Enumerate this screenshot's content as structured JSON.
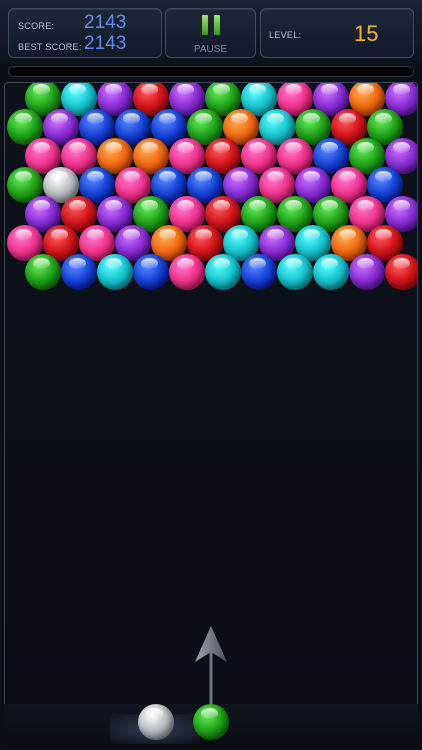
{
  "hud": {
    "score_label": "SCORE:",
    "score_value": "2143",
    "best_label": "BEST SCORE:",
    "best_value": "2143",
    "pause_label": "PAUSE",
    "level_label": "LEVEL:",
    "level_value": "15"
  },
  "colors": {
    "score_value": "#5c8ef0",
    "level_value": "#f3b23a",
    "pause_icon": "#55c23c"
  },
  "palette": {
    "G": "#22a51a",
    "C": "#19c6cf",
    "P": "#8b2fd6",
    "R": "#d2161c",
    "K": "#f0358e",
    "O": "#f06b12",
    "B": "#1745d8",
    "W": "#b9bec2"
  },
  "grid": [
    "GCPRPGCKPOP",
    "GPBBBGOCGRG",
    "KKOOKRKKBGP",
    "GWBKBBPKPKB",
    "PRPGKRGGGKP",
    "KRKPORCPCOR",
    "GBCBKCBCCPR"
  ],
  "shooter": {
    "current_color": "G",
    "next_color": "W"
  },
  "icons": {
    "pause": "pause-icon",
    "aim": "aim-arrow-icon"
  }
}
